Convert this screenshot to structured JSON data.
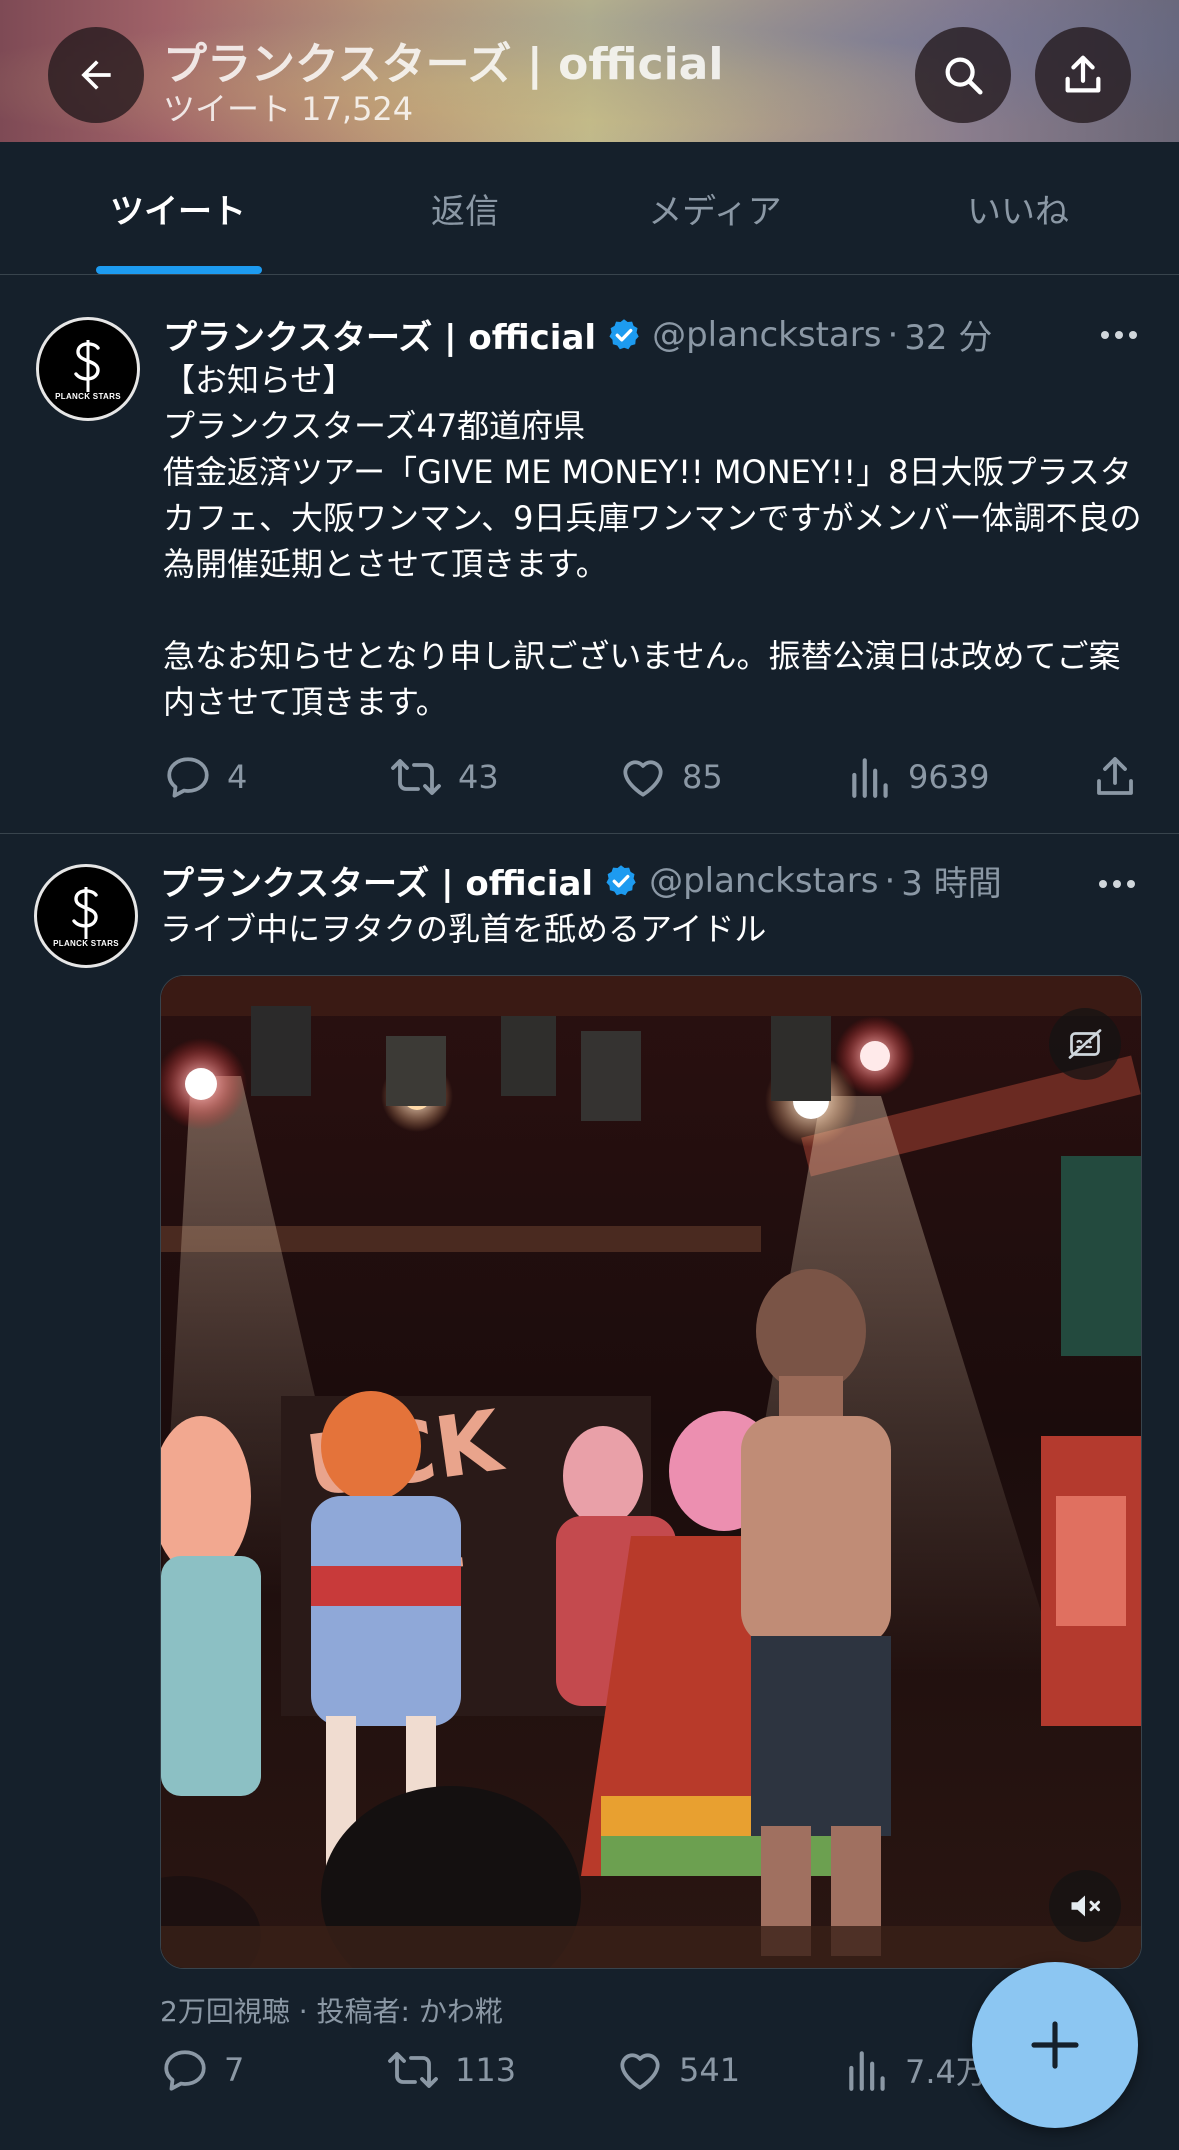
{
  "header": {
    "title": "プランクスターズ | official",
    "tweet_count": "ツイート 17,524"
  },
  "tabs": [
    {
      "label": "ツイート",
      "active": true
    },
    {
      "label": "返信",
      "active": false
    },
    {
      "label": "メディア",
      "active": false
    },
    {
      "label": "いいね",
      "active": false
    }
  ],
  "tweets": [
    {
      "display_name": "プランクスターズ | official",
      "handle": "@planckstars",
      "separator": "·",
      "time": "32 分",
      "avatar_text": "PLANCK STARS",
      "text": "【お知らせ】\nプランクスターズ47都道府県\n借金返済ツアー「GIVE ME MONEY!! MONEY!!」8日大阪プラスタカフェ、大阪ワンマン、9日兵庫ワンマンですがメンバー体調不良の為開催延期とさせて頂きます。\n\n急なお知らせとなり申し訳ございません。振替公演日は改めてご案内させて頂きます。",
      "replies": "4",
      "retweets": "43",
      "likes": "85",
      "views": "9639"
    },
    {
      "display_name": "プランクスターズ | official",
      "handle": "@planckstars",
      "separator": "·",
      "time": "3 時間",
      "avatar_text": "PLANCK STARS",
      "text": "ライブ中にヲタクの乳首を舐めるアイドル",
      "media_views_line": "2万回視聴 · 投稿者: かわ糀",
      "replies": "7",
      "retweets": "113",
      "likes": "541",
      "views": "7.4万"
    }
  ],
  "colors": {
    "background": "#15202b",
    "accent": "#1d9bf0",
    "secondary_text": "#8b98a5",
    "fab": "#8cc6f2"
  },
  "icons": [
    "back-arrow-icon",
    "search-icon",
    "share-icon",
    "verified-badge-icon",
    "more-icon",
    "reply-icon",
    "retweet-icon",
    "like-icon",
    "views-icon",
    "caption-off-icon",
    "mute-icon",
    "plus-icon"
  ]
}
